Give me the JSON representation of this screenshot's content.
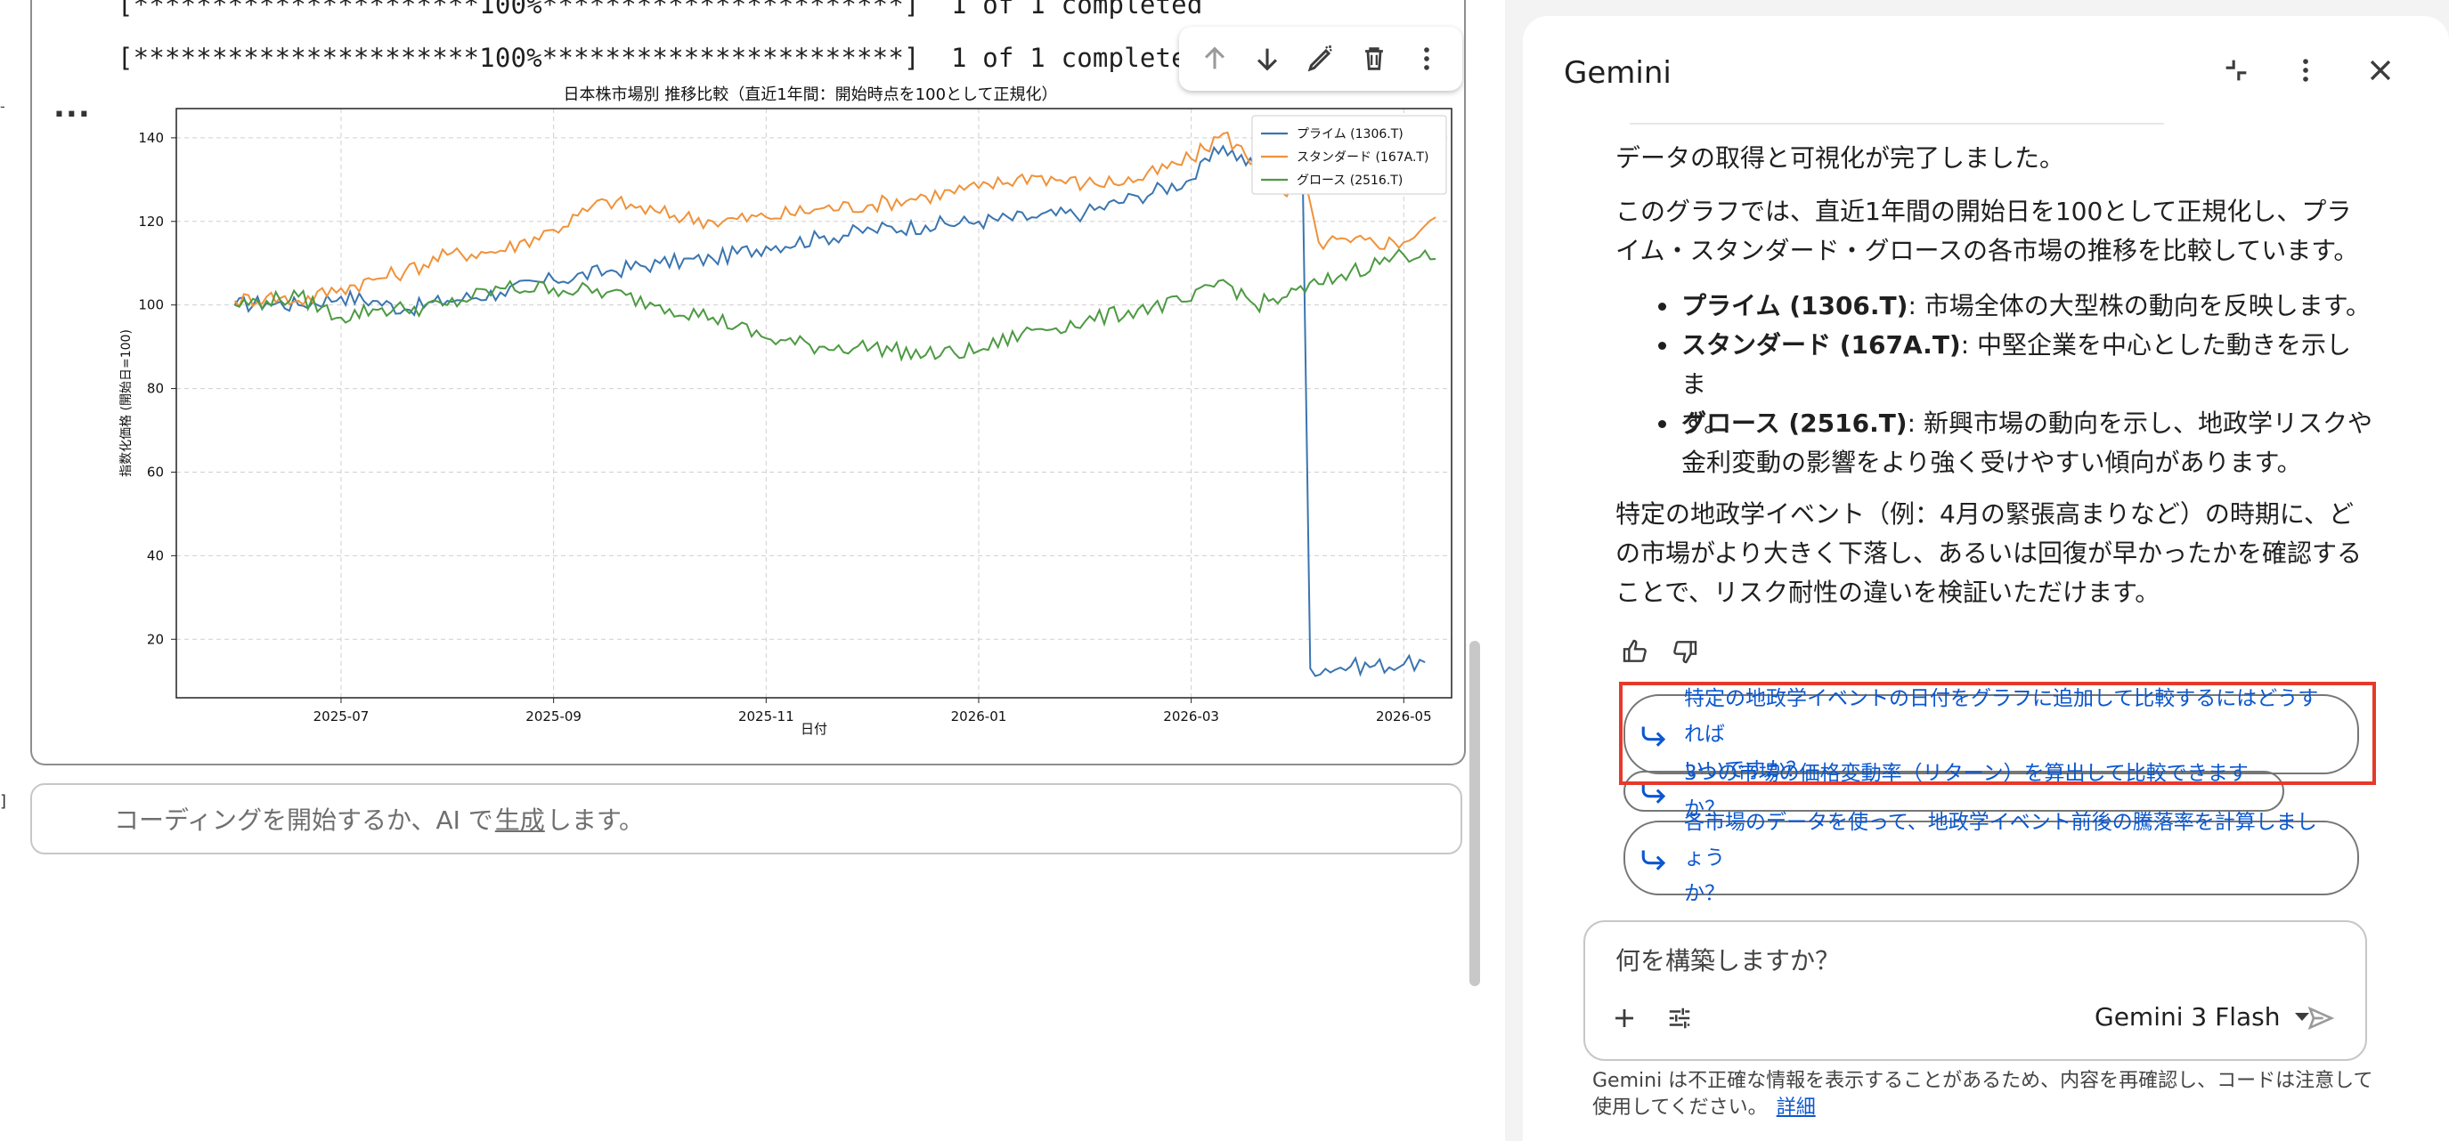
{
  "notebook": {
    "progress_lines": [
      "[**********************100%***********************]  1 of 1 completed",
      "[**********************100%***********************]  1 of 1 completed"
    ],
    "more_label": "...",
    "left_marks": [
      "-",
      "]"
    ],
    "code_input": {
      "prefix": "コーディングを開始するか、AI で",
      "link": "生成",
      "suffix": "します。"
    },
    "toolbar_icons": [
      "arrow-up-icon",
      "arrow-down-icon",
      "edit-icon",
      "delete-icon",
      "more-vert-icon"
    ]
  },
  "chart_data": {
    "type": "line",
    "title": "日本株市場別 推移比較（直近1年間：開始時点を100として正規化）",
    "xlabel": "日付",
    "ylabel": "指数化価格 (開始日=100)",
    "x_ticks": [
      "2025-07",
      "2025-09",
      "2025-11",
      "2026-01",
      "2026-03",
      "2026-05"
    ],
    "y_ticks": [
      20,
      40,
      60,
      80,
      100,
      120,
      140
    ],
    "ylim": [
      6,
      147
    ],
    "xlim_months": [
      -0.55,
      11.45
    ],
    "x_tick_months": [
      1,
      3,
      5,
      7,
      9,
      11
    ],
    "grid": true,
    "legend_position": "top-right",
    "series": [
      {
        "name": "プライム (1306.T)",
        "color": "#3a75b0",
        "points": [
          [
            0,
            100
          ],
          [
            0.3,
            100.5
          ],
          [
            0.6,
            100
          ],
          [
            1,
            102
          ],
          [
            1.3,
            101
          ],
          [
            1.6,
            99
          ],
          [
            2,
            101
          ],
          [
            2.5,
            103
          ],
          [
            3,
            106
          ],
          [
            3.5,
            108
          ],
          [
            4,
            110
          ],
          [
            4.5,
            111
          ],
          [
            5,
            114
          ],
          [
            5.5,
            116
          ],
          [
            6,
            118
          ],
          [
            6.5,
            119
          ],
          [
            7,
            120
          ],
          [
            7.5,
            121
          ],
          [
            8,
            122
          ],
          [
            8.5,
            126
          ],
          [
            9,
            130
          ],
          [
            9.3,
            138
          ],
          [
            9.6,
            133
          ],
          [
            9.9,
            128
          ],
          [
            10.05,
            130
          ],
          [
            10.12,
            13
          ],
          [
            10.5,
            13.5
          ],
          [
            11,
            14
          ],
          [
            11.2,
            14.5
          ]
        ]
      },
      {
        "name": "スタンダード (167A.T)",
        "color": "#f0923a",
        "points": [
          [
            0,
            101
          ],
          [
            0.3,
            102
          ],
          [
            0.6,
            101
          ],
          [
            1,
            104
          ],
          [
            1.3,
            106
          ],
          [
            1.6,
            108
          ],
          [
            2,
            112
          ],
          [
            2.5,
            113
          ],
          [
            3,
            118
          ],
          [
            3.5,
            125
          ],
          [
            4,
            122
          ],
          [
            4.5,
            120
          ],
          [
            5,
            121
          ],
          [
            5.5,
            123
          ],
          [
            6,
            124
          ],
          [
            6.5,
            126
          ],
          [
            7,
            128
          ],
          [
            7.5,
            131
          ],
          [
            8,
            129
          ],
          [
            8.5,
            130
          ],
          [
            9,
            135
          ],
          [
            9.3,
            141
          ],
          [
            9.6,
            134
          ],
          [
            9.9,
            126
          ],
          [
            10.05,
            130
          ],
          [
            10.2,
            115
          ],
          [
            10.5,
            115
          ],
          [
            11,
            115
          ],
          [
            11.2,
            119
          ],
          [
            11.3,
            121
          ]
        ]
      },
      {
        "name": "グロース (2516.T)",
        "color": "#4c9a42",
        "points": [
          [
            0,
            100
          ],
          [
            0.3,
            101
          ],
          [
            0.6,
            102
          ],
          [
            1,
            97
          ],
          [
            1.3,
            99
          ],
          [
            1.6,
            99
          ],
          [
            2,
            100
          ],
          [
            2.5,
            104
          ],
          [
            3,
            104
          ],
          [
            3.5,
            103
          ],
          [
            4,
            100
          ],
          [
            4.5,
            97
          ],
          [
            5,
            92
          ],
          [
            5.5,
            90
          ],
          [
            6,
            90
          ],
          [
            6.5,
            88
          ],
          [
            7,
            89
          ],
          [
            7.5,
            94
          ],
          [
            8,
            96
          ],
          [
            8.5,
            99
          ],
          [
            9,
            101
          ],
          [
            9.3,
            106
          ],
          [
            9.6,
            100
          ],
          [
            9.9,
            102
          ],
          [
            10.2,
            105
          ],
          [
            10.5,
            108
          ],
          [
            11,
            112
          ],
          [
            11.2,
            113
          ],
          [
            11.3,
            111
          ]
        ]
      }
    ]
  },
  "panel": {
    "title": "Gemini",
    "header_icons": [
      "collapse-icon",
      "more-vert-icon",
      "close-icon"
    ],
    "message_intro": "データの取得と可視化が完了しました。",
    "message_p2_line1": "このグラフでは、直近1年間の開始日を100として正規化し、プラ",
    "message_p2_line2": "イム・スタンダード・グロースの各市場の推移を比較しています。",
    "bullets": [
      {
        "bold": "プライム (1306.T)",
        "text_lines": [
          ": 市場全体の大型株の動向を反映します。"
        ]
      },
      {
        "bold": "スタンダード (167A.T)",
        "text_lines": [
          ": 中堅企業を中心とした動きを示しま",
          "す。"
        ]
      },
      {
        "bold": "グロース (2516.T)",
        "text_lines": [
          ": 新興市場の動向を示し、地政学リスクや",
          "金利変動の影響をより強く受けやすい傾向があります。"
        ]
      }
    ],
    "message_p3_lines": [
      "特定の地政学イベント（例：4月の緊張高まりなど）の時期に、ど",
      "の市場がより大きく下落し、あるいは回復が早かったかを確認する",
      "ことで、リスク耐性の違いを検証いただけます。"
    ],
    "suggestions": [
      {
        "lines": [
          "特定の地政学イベントの日付をグラフに追加して比較するにはどうすれば",
          "いいですか？"
        ]
      },
      {
        "lines": [
          "3つの市場の価格変動率（リターン）を算出して比較できますか？"
        ]
      },
      {
        "lines": [
          "各市場のデータを使って、地政学イベント前後の騰落率を計算しましょう",
          "か？"
        ]
      }
    ],
    "prompt_placeholder": "何を構築しますか？",
    "model_name": "Gemini 3 Flash",
    "disclaimer_line1": "Gemini は不正確な情報を表示することがあるため、内容を再確認し、コードは注意して",
    "disclaimer_line2": "使用してください。",
    "disclaimer_link": "詳細",
    "colors": {
      "accent": "#0b57d0",
      "highlight": "#e53a2b"
    }
  }
}
